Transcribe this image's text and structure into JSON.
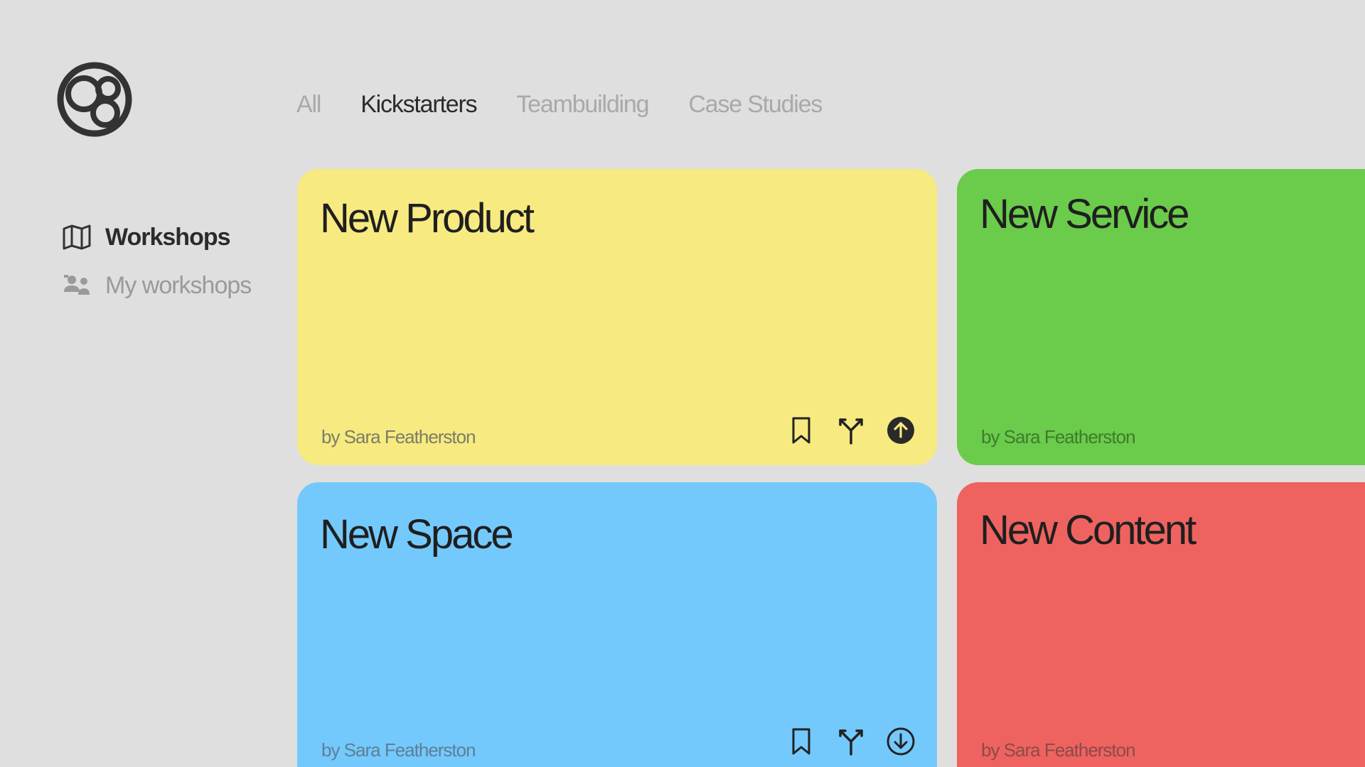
{
  "colors": {
    "background": "#dfdfdf",
    "yellow": "#f7ea80",
    "green": "#6bcb4b",
    "blue": "#74c9fc",
    "red": "#ee6360",
    "dark": "#2b2b2b",
    "muted": "#a9a9a9"
  },
  "logo": {
    "icon": "circles-logo-icon"
  },
  "sidebar": {
    "items": [
      {
        "label": "Workshops",
        "icon": "map-icon",
        "active": true
      },
      {
        "label": "My workshops",
        "icon": "people-icon",
        "active": false
      }
    ]
  },
  "tabs": [
    {
      "label": "All",
      "active": false
    },
    {
      "label": "Kickstarters",
      "active": true
    },
    {
      "label": "Teambuilding",
      "active": false
    },
    {
      "label": "Case Studies",
      "active": false
    }
  ],
  "cards": [
    {
      "title": "New Product",
      "author": "by Sara Featherston",
      "color": "#f7ea80",
      "actions": [
        "bookmark-icon",
        "fork-icon",
        "upload-circle-icon"
      ]
    },
    {
      "title": "New Service",
      "author": "by Sara Featherston",
      "color": "#6bcb4b",
      "actions": []
    },
    {
      "title": "New Space",
      "author": "by Sara Featherston",
      "color": "#74c9fc",
      "actions": [
        "bookmark-icon",
        "fork-icon",
        "download-circle-icon"
      ]
    },
    {
      "title": "New Content",
      "author": "by Sara Featherston",
      "color": "#ee6360",
      "actions": []
    }
  ]
}
